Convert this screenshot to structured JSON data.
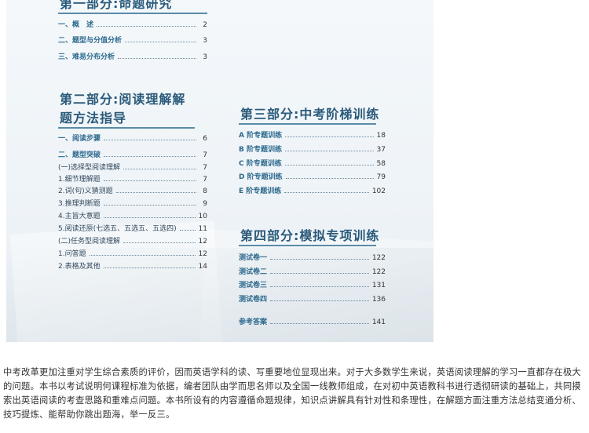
{
  "part1": {
    "title": "第一部分:命题研究",
    "entries": [
      {
        "label": "一、概　述",
        "page": "2"
      },
      {
        "label": "二、题型与分值分析",
        "page": "3"
      },
      {
        "label": "三、难易分布分析",
        "page": "3"
      }
    ]
  },
  "part2": {
    "title_line1": "第二部分:阅读理解解",
    "title_line2": "题方法指导",
    "entries": [
      {
        "label": "一、阅读步骤",
        "page": "6",
        "bold": true
      },
      {
        "label": "二、题型突破",
        "page": "7",
        "bold": true
      },
      {
        "label": "(一)选择型阅读理解",
        "page": "7",
        "bold": false
      },
      {
        "label": "1.细节理解题",
        "page": "7",
        "bold": false
      },
      {
        "label": "2.词(句)义猜测题",
        "page": "8",
        "bold": false
      },
      {
        "label": "3.推理判断题",
        "page": "9",
        "bold": false
      },
      {
        "label": "4.主旨大意题",
        "page": "10",
        "bold": false
      },
      {
        "label": "5.阅读还原(七选五、五选五、五选四)",
        "page": "11",
        "bold": false
      },
      {
        "label": "(二)任务型阅读理解",
        "page": "12",
        "bold": false
      },
      {
        "label": "1.问答题",
        "page": "12",
        "bold": false
      },
      {
        "label": "2.表格及其他",
        "page": "14",
        "bold": false
      }
    ]
  },
  "part3": {
    "title": "第三部分:中考阶梯训练",
    "entries": [
      {
        "label": "A 阶专题训练",
        "page": "18"
      },
      {
        "label": "B 阶专题训练",
        "page": "37"
      },
      {
        "label": "C 阶专题训练",
        "page": "58"
      },
      {
        "label": "D 阶专题训练",
        "page": "79"
      },
      {
        "label": "E 阶专题训练",
        "page": "102"
      }
    ]
  },
  "part4": {
    "title": "第四部分:模拟专项训练",
    "entries": [
      {
        "label": "测试卷一",
        "page": "122"
      },
      {
        "label": "测试卷二",
        "page": "122"
      },
      {
        "label": "测试卷三",
        "page": "131"
      },
      {
        "label": "测试卷四",
        "page": "136"
      }
    ],
    "answers": {
      "label": "参考答案",
      "page": "141"
    }
  },
  "description": "中考改革更加注重对学生综合素质的评价，因而英语学科的读、写重要地位显现出来。对于大多数学生来说，英语阅读理解的学习一直都存在极大的问题。本书以考试说明何课程标准为依据，编者团队由学而思名师以及全国一线教师组成，在对初中英语教科书进行透彻研读的基础上，共同摸索出英语阅读的考查思路和重难点问题。本书所设有的内容遵循命题规律，知识点讲解具有针对性和条理性，在解题方面注重方法总结变通分析、技巧提炼、能帮助你跳出题海，举一反三。"
}
